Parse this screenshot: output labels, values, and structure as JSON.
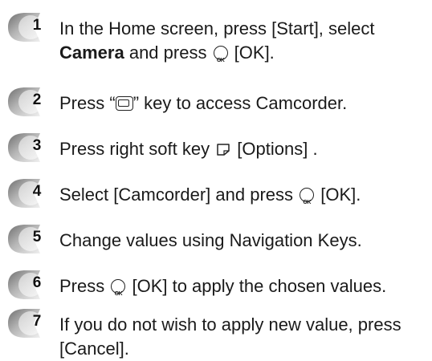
{
  "steps": [
    {
      "number": "1",
      "line1_pre": "In the Home screen, press [Start], select",
      "bold": "Camera",
      "line2_mid": " and press ",
      "line2_post": " [OK]."
    },
    {
      "number": "2",
      "pre": "Press “",
      "post": "” key to access Camcorder."
    },
    {
      "number": "3",
      "pre": "Press right soft key ",
      "post": " [Options] ."
    },
    {
      "number": "4",
      "pre": "Select [Camcorder] and press ",
      "post": " [OK]."
    },
    {
      "number": "5",
      "text": "Change values using Navigation Keys."
    },
    {
      "number": "6",
      "pre": "Press ",
      "post": " [OK] to apply the chosen values."
    },
    {
      "number": "7",
      "line1": "If you do not wish to apply new value, press",
      "line2": "[Cancel]."
    }
  ],
  "icons": {
    "ok_icon": "ok-button-icon",
    "camera_key": "camera-key-icon",
    "right_softkey": "right-softkey-icon",
    "ok_glyph": "OK"
  },
  "colors": {
    "badge_dark": "#8a8a8a",
    "badge_light": "#e6e6e6"
  }
}
